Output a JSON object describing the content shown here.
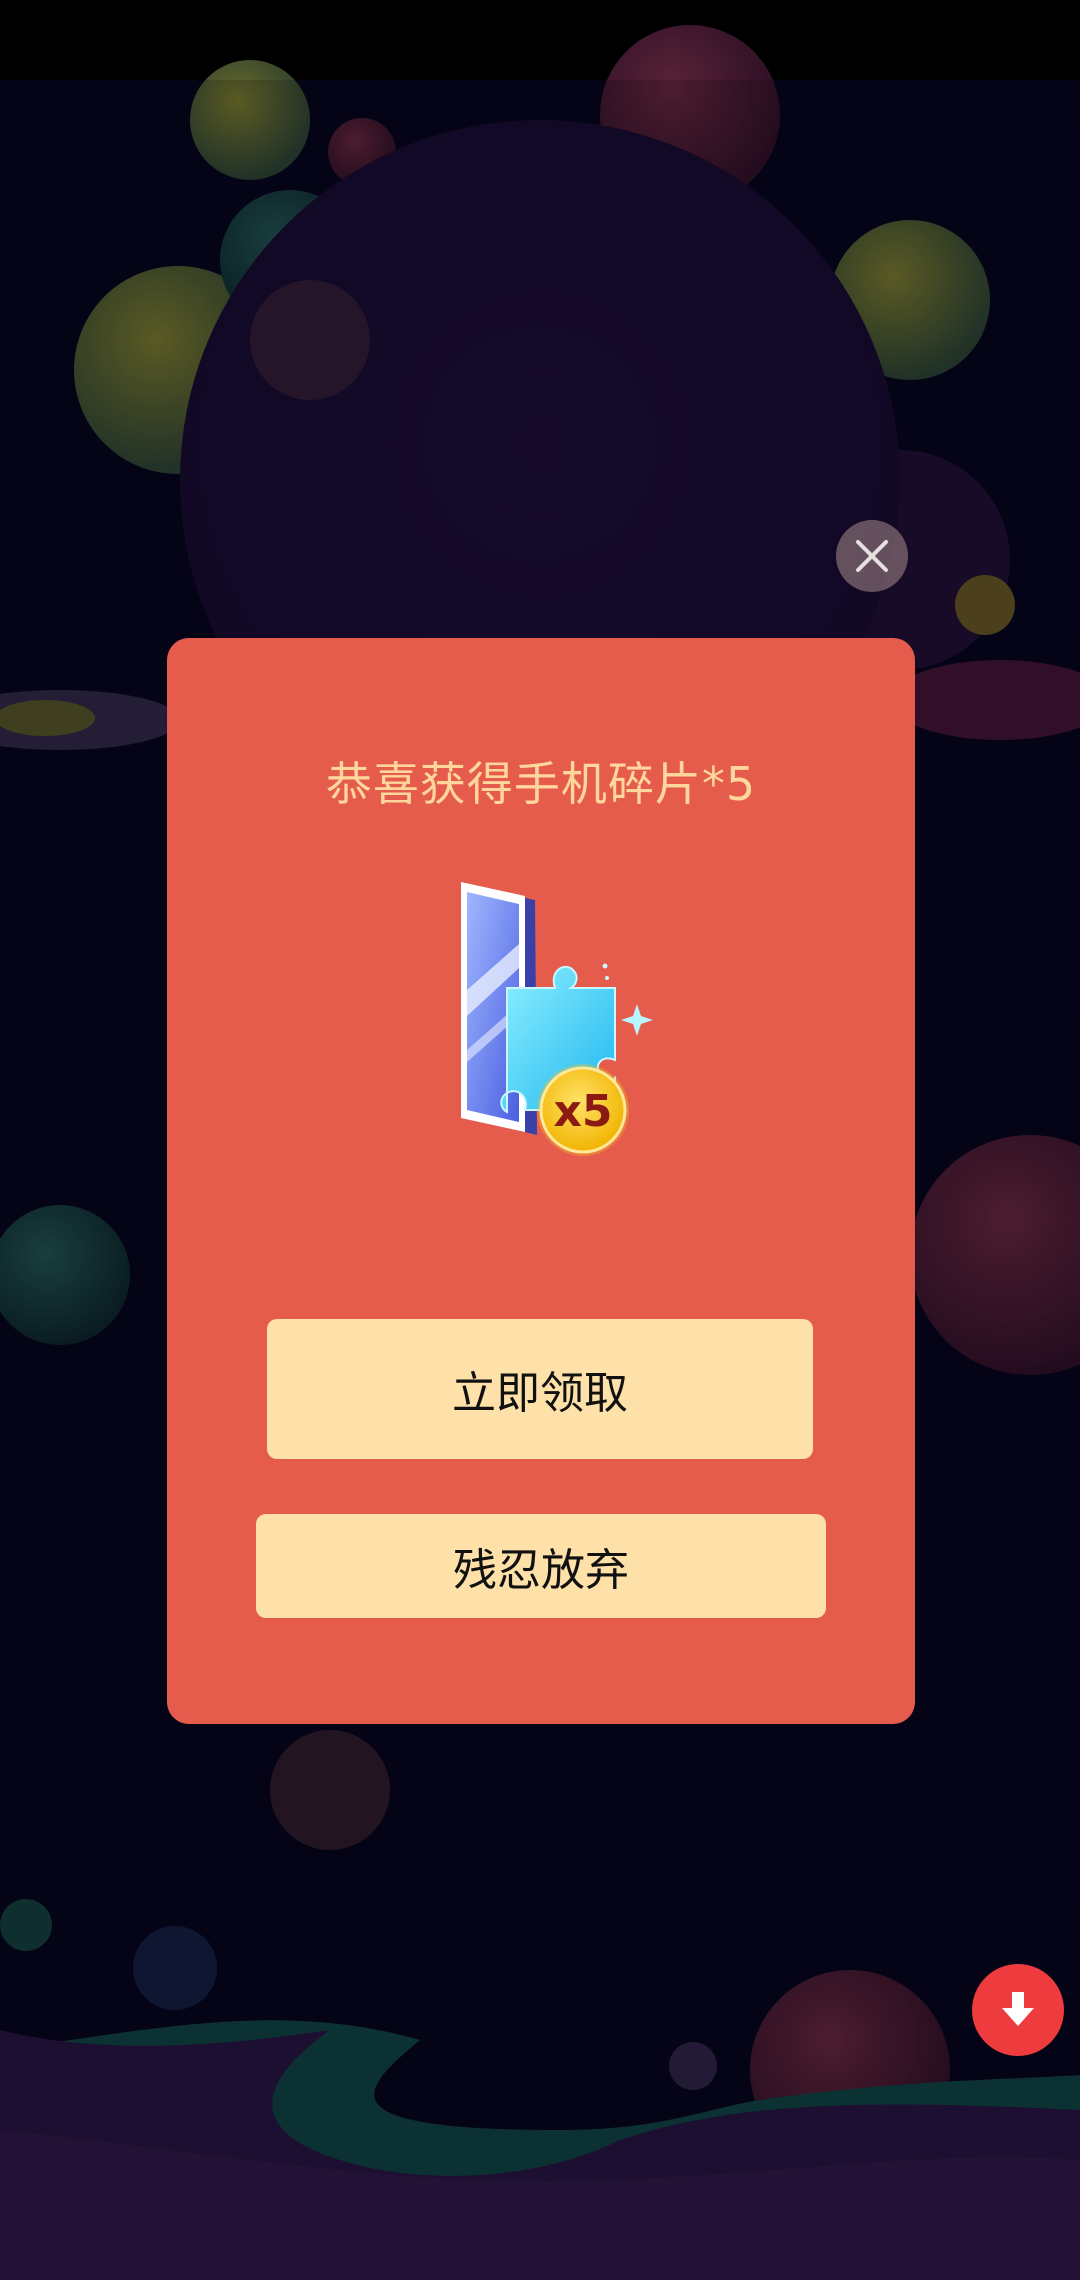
{
  "dialog": {
    "title": "恭喜获得手机碎片*5",
    "badge_text": "x5",
    "claim_button": "立即领取",
    "giveup_button": "残忍放弃"
  },
  "icons": {
    "close": "close-icon",
    "download": "download-arrow-icon",
    "reward": "phone-puzzle-fragment-icon"
  },
  "colors": {
    "dialog_bg": "#e55b4c",
    "title_text": "#ffd79c",
    "button_bg": "#fde1a9",
    "download_fab": "#ee3c3e",
    "badge": "#f7c51e"
  }
}
